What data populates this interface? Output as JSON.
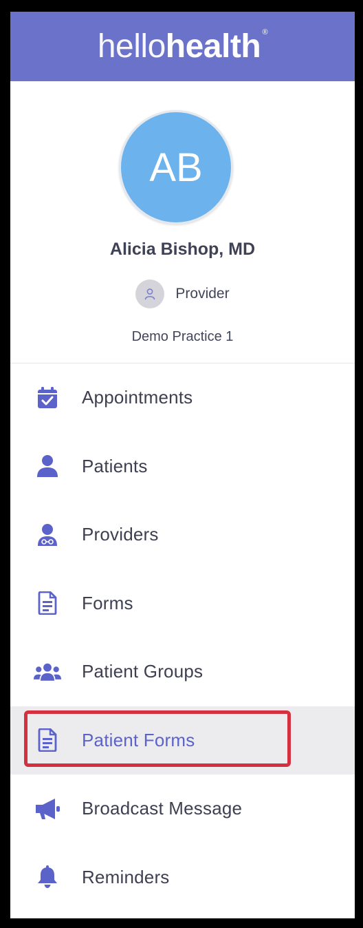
{
  "header": {
    "logo_light": "hello",
    "logo_bold": "health",
    "logo_mark": "®",
    "color": "#6b72c9"
  },
  "profile": {
    "initials": "AB",
    "avatar_color": "#6cb2ec",
    "name": "Alicia Bishop, MD",
    "role_icon": "user-icon",
    "role": "Provider",
    "practice": "Demo Practice 1"
  },
  "nav": {
    "accent": "#5b62c9",
    "items": [
      {
        "label": "Appointments",
        "icon": "calendar-check-icon"
      },
      {
        "label": "Patients",
        "icon": "user-icon"
      },
      {
        "label": "Providers",
        "icon": "doctor-icon"
      },
      {
        "label": "Forms",
        "icon": "document-icon"
      },
      {
        "label": "Patient Groups",
        "icon": "users-group-icon"
      },
      {
        "label": "Patient Forms",
        "icon": "document-icon",
        "active": true
      },
      {
        "label": "Broadcast Message",
        "icon": "megaphone-icon"
      },
      {
        "label": "Reminders",
        "icon": "bell-icon"
      }
    ]
  },
  "annotation": {
    "highlight_color": "#d5303f",
    "highlighted_item": "Patient Forms"
  }
}
